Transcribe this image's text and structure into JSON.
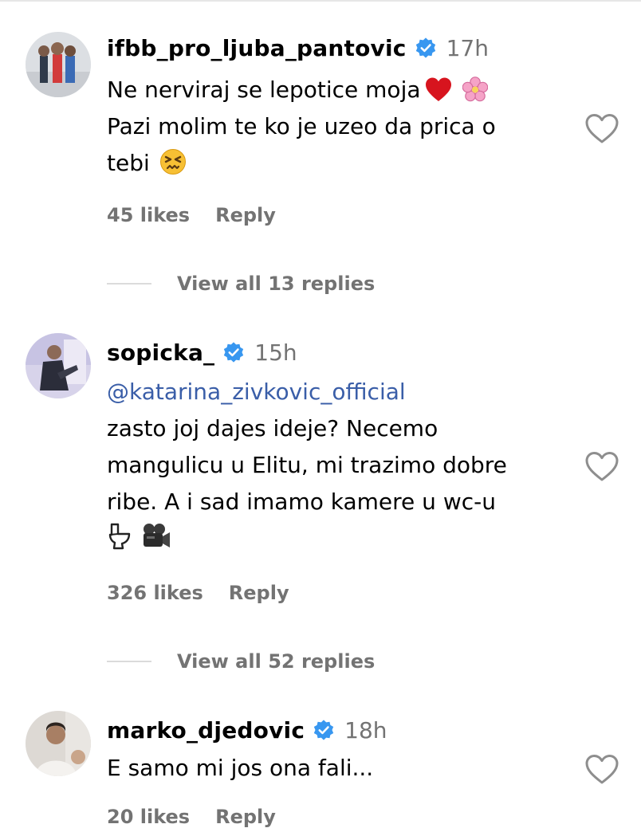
{
  "comments": [
    {
      "username": "ifbb_pro_ljuba_pantovic",
      "time": "17h",
      "lines": [
        "Ne nerviraj se lepotice moja",
        "Pazi molim te ko je uzeo da prica o",
        "tebi"
      ],
      "emoji_icons": [
        "red-heart-icon",
        "cherry-blossom-icon",
        "confounded-face-icon"
      ],
      "likes": "45 likes",
      "reply": "Reply",
      "view_replies": "View all 13 replies"
    },
    {
      "username": "sopicka_",
      "time": "15h",
      "mention": "@katarina_zivkovic_official",
      "lines": [
        "zasto joj dajes ideje? Necemo",
        "mangulicu u Elitu, mi trazimo dobre",
        "ribe. A i sad imamo kamere u wc-u"
      ],
      "emoji_icons": [
        "toilet-icon",
        "video-camera-icon"
      ],
      "likes": "326 likes",
      "reply": "Reply",
      "view_replies": "View all 52 replies"
    },
    {
      "username": "marko_djedovic",
      "time": "18h",
      "lines": [
        "E samo mi jos ona fali..."
      ],
      "likes": "20 likes",
      "reply": "Reply"
    }
  ],
  "colors": {
    "text": "#000000",
    "secondary": "#737373",
    "mention": "#3a5ea8",
    "verified": "#3897f0",
    "heart_outline": "#8e8e8e"
  }
}
